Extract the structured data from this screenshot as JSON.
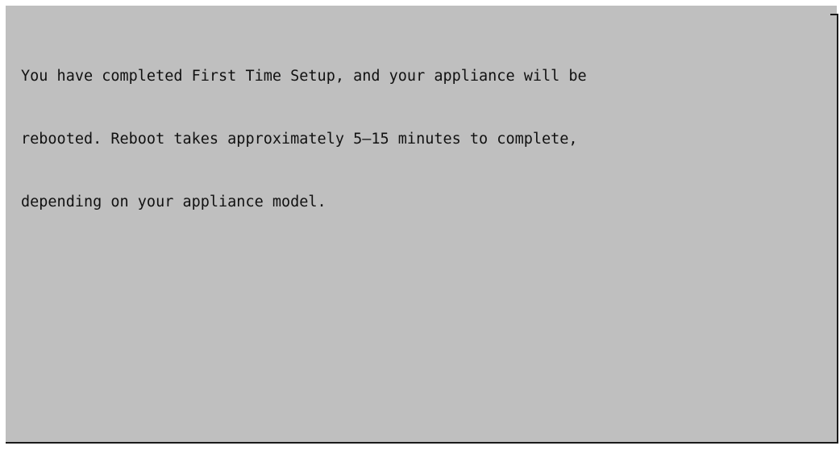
{
  "screen": {
    "background_color": "#bfbfbf",
    "text_color": "#111111",
    "border_color": "#1a1a1a"
  },
  "message": {
    "lines": [
      "You have completed First Time Setup, and your appliance will be",
      "rebooted. Reboot takes approximately 5–15 minutes to complete,",
      "depending on your appliance model."
    ]
  }
}
